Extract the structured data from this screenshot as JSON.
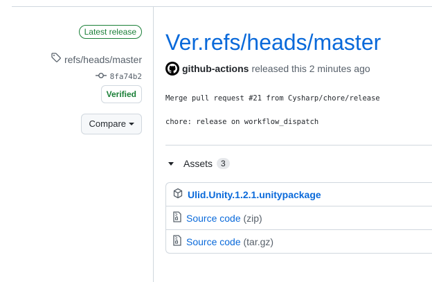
{
  "sidebar": {
    "latest_badge": "Latest release",
    "tag": "refs/heads/master",
    "commit": "8fa74b2",
    "verified": "Verified",
    "compare": "Compare"
  },
  "release": {
    "title": "Ver.refs/heads/master",
    "author": "github-actions",
    "released_text": "released this 2 minutes ago",
    "body": [
      "Merge pull request #21 from Cysharp/chore/release",
      "chore: release on workflow_dispatch"
    ]
  },
  "assets": {
    "label": "Assets",
    "count": "3",
    "items": [
      {
        "name": "Ulid.Unity.1.2.1.unitypackage",
        "icon": "package-icon"
      },
      {
        "name": "Source code",
        "suffix": "(zip)",
        "icon": "file-zip-icon"
      },
      {
        "name": "Source code",
        "suffix": "(tar.gz)",
        "icon": "file-zip-icon"
      }
    ]
  },
  "colors": {
    "link": "#0969da",
    "success": "#1a7f37",
    "border": "#d0d7de",
    "muted": "#57606a"
  }
}
